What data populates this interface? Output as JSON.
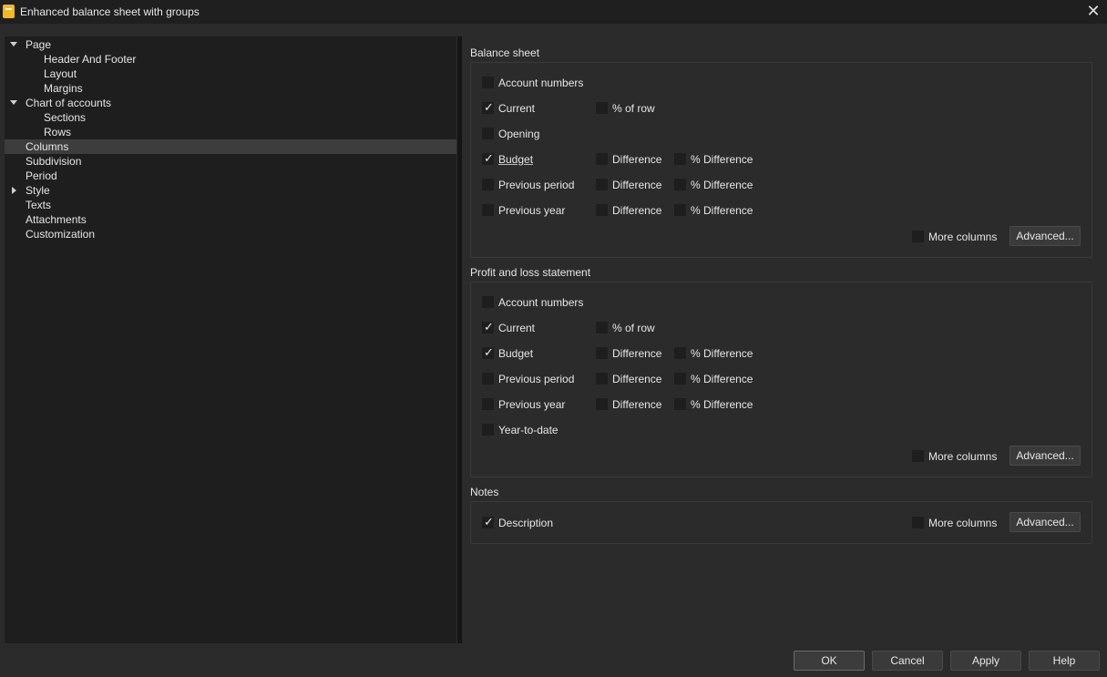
{
  "window": {
    "title": "Enhanced balance sheet with groups"
  },
  "tree": {
    "items": [
      {
        "label": "Page"
      },
      {
        "label": "Header And Footer"
      },
      {
        "label": "Layout"
      },
      {
        "label": "Margins"
      },
      {
        "label": "Chart of accounts"
      },
      {
        "label": "Sections"
      },
      {
        "label": "Rows"
      },
      {
        "label": "Columns"
      },
      {
        "label": "Subdivision"
      },
      {
        "label": "Period"
      },
      {
        "label": "Style"
      },
      {
        "label": "Texts"
      },
      {
        "label": "Attachments"
      },
      {
        "label": "Customization"
      }
    ]
  },
  "balance_sheet": {
    "title": "Balance sheet",
    "account_numbers": "Account numbers",
    "current": "Current",
    "pct_of_row": "% of row",
    "opening": "Opening",
    "budget": "Budget",
    "difference": "Difference",
    "pct_difference": "% Difference",
    "previous_period": "Previous period",
    "previous_year": "Previous year",
    "more_columns": "More columns",
    "advanced": "Advanced..."
  },
  "profit_loss": {
    "title": "Profit and loss statement",
    "account_numbers": "Account numbers",
    "current": "Current",
    "pct_of_row": "% of row",
    "budget": "Budget",
    "difference": "Difference",
    "pct_difference": "% Difference",
    "previous_period": "Previous period",
    "previous_year": "Previous year",
    "year_to_date": "Year-to-date",
    "more_columns": "More columns",
    "advanced": "Advanced..."
  },
  "notes": {
    "title": "Notes",
    "description": "Description",
    "more_columns": "More columns",
    "advanced": "Advanced..."
  },
  "buttons": {
    "ok": "OK",
    "cancel": "Cancel",
    "apply": "Apply",
    "help": "Help"
  }
}
